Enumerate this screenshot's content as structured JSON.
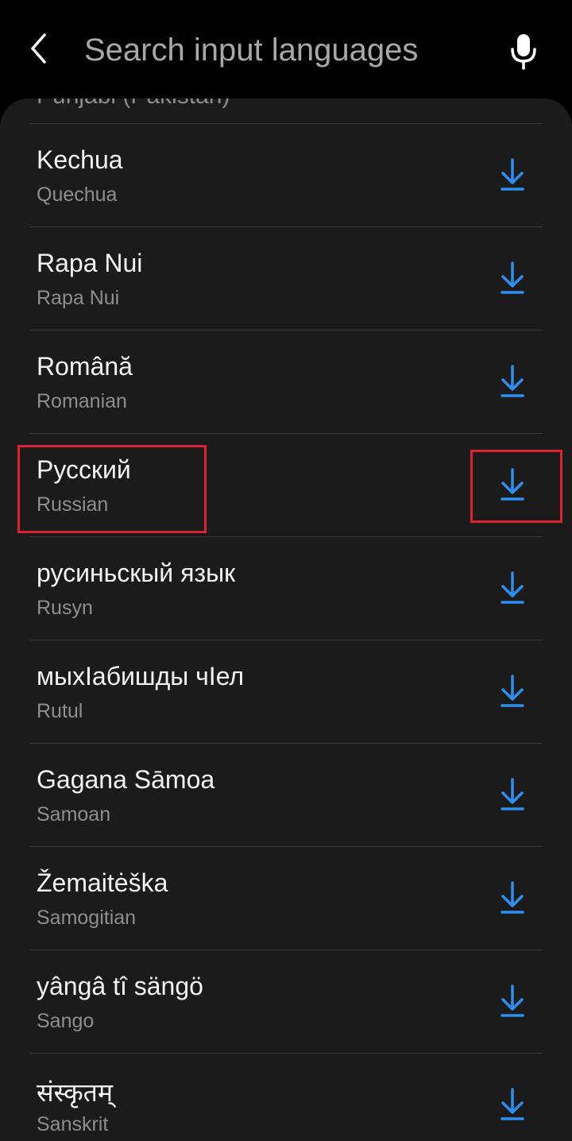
{
  "colors": {
    "background": "#000000",
    "panel": "#1b1b1b",
    "divider": "#3a3a3a",
    "accent": "#2f8ff0",
    "highlight": "#d9232e",
    "primary_text": "#f4f4f4",
    "secondary_text": "#8e8e8e"
  },
  "header": {
    "back_icon": "chevron-left-icon",
    "search_placeholder": "Search input languages",
    "search_value": "",
    "mic_icon": "microphone-icon"
  },
  "list": {
    "partial_item_label": "Punjabi (Pakistan)",
    "download_icon": "download-icon",
    "items": [
      {
        "native": "Kechua",
        "english": "Quechua"
      },
      {
        "native": "Rapa Nui",
        "english": "Rapa Nui"
      },
      {
        "native": "Română",
        "english": "Romanian"
      },
      {
        "native": "Русский",
        "english": "Russian"
      },
      {
        "native": "русиньскый язык",
        "english": "Rusyn"
      },
      {
        "native": "мыхIабишды чIел",
        "english": "Rutul"
      },
      {
        "native": "Gagana Sāmoa",
        "english": "Samoan"
      },
      {
        "native": "Žemaitėška",
        "english": "Samogitian"
      },
      {
        "native": "yângâ tî sängö",
        "english": "Sango"
      },
      {
        "native": "संस्कृतम्",
        "english": "Sanskrit"
      }
    ]
  }
}
